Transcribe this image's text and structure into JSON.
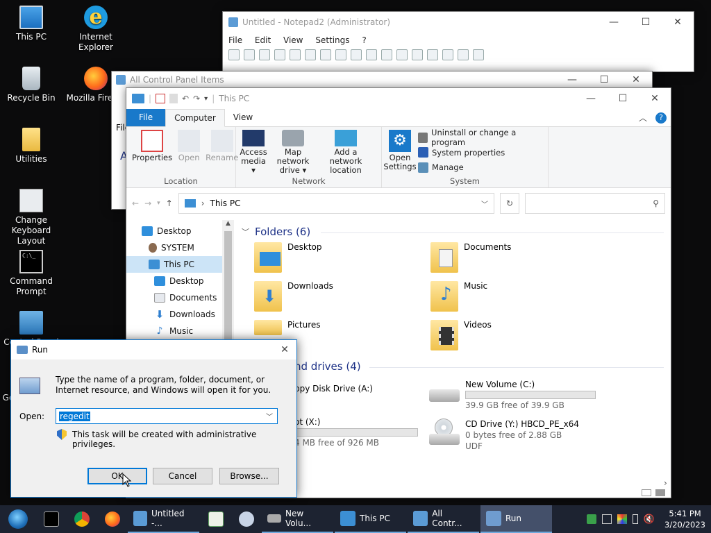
{
  "desktop": {
    "icons": [
      {
        "label": "This PC"
      },
      {
        "label": "Internet Explorer"
      },
      {
        "label": "Recycle Bin"
      },
      {
        "label": "Mozilla Firefox"
      },
      {
        "label": "Utilities"
      },
      {
        "label": "Change Keyboard Layout"
      },
      {
        "label": "Command Prompt"
      },
      {
        "label": "Control Panel"
      },
      {
        "label": "Go"
      }
    ]
  },
  "notepad": {
    "title": "Untitled - Notepad2 (Administrator)",
    "menu": [
      "File",
      "Edit",
      "View",
      "Settings",
      "?"
    ]
  },
  "cpanel": {
    "title": "All Control Panel Items",
    "menu_file": "File",
    "text_a": "A"
  },
  "explorer": {
    "title": "This PC",
    "tabs": {
      "file": "File",
      "computer": "Computer",
      "view": "View"
    },
    "ribbon": {
      "location": {
        "label": "Location",
        "properties": "Properties",
        "open": "Open",
        "rename": "Rename"
      },
      "network": {
        "label": "Network",
        "access_media": "Access media ▾",
        "map_drive": "Map network drive ▾",
        "add_location": "Add a network location"
      },
      "system": {
        "label": "System",
        "open_settings": "Open Settings",
        "uninstall": "Uninstall or change a program",
        "sys_props": "System properties",
        "manage": "Manage"
      }
    },
    "address": "This PC",
    "nav": {
      "desktop": "Desktop",
      "system": "SYSTEM",
      "thispc": "This PC",
      "desktop2": "Desktop",
      "documents": "Documents",
      "downloads": "Downloads",
      "music": "Music"
    },
    "folders_header": "Folders (6)",
    "folders": {
      "desktop": "Desktop",
      "documents": "Documents",
      "downloads": "Downloads",
      "music": "Music",
      "pictures": "Pictures",
      "videos": "Videos"
    },
    "drives_header": "nd drives (4)",
    "drives": {
      "floppy": "ppy Disk Drive (A:)",
      "x_name": "ot (X:)",
      "x_free": "4 MB free of 926 MB",
      "c_name": "New Volume (C:)",
      "c_free": "39.9 GB free of 39.9 GB",
      "c_fill": 0.0,
      "y_name": "CD Drive (Y:) HBCD_PE_x64",
      "y_free": "0 bytes free of 2.88 GB",
      "y_fs": "UDF",
      "x_fill": 0.99
    }
  },
  "run": {
    "title": "Run",
    "description": "Type the name of a program, folder, document, or Internet resource, and Windows will open it for you.",
    "open_label": "Open:",
    "input_value": "regedit",
    "admin_note": "This task will be created with administrative privileges.",
    "ok": "OK",
    "cancel": "Cancel",
    "browse": "Browse..."
  },
  "taskbar": {
    "apps": [
      {
        "label": "Untitled -..."
      },
      {
        "label": "New Volu..."
      },
      {
        "label": "This PC"
      },
      {
        "label": "All Contr..."
      },
      {
        "label": "Run"
      }
    ],
    "time": "5:41 PM",
    "date": "3/20/2023"
  },
  "colors": {
    "accent": "#1979ca",
    "taskbar": "#1d2331",
    "selection": "#cce4f7",
    "drive_bar": "#26a0da"
  }
}
